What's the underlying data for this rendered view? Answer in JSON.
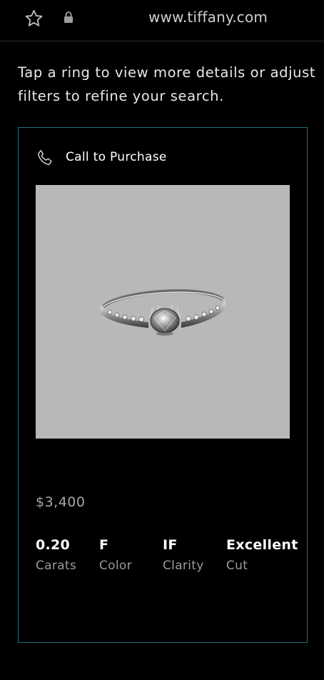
{
  "browser": {
    "url": "www.tiffany.com",
    "icons": [
      "star-icon",
      "lock-icon"
    ]
  },
  "intro_text": {
    "line1": "Tap a ring to view more details or adjust",
    "line2": "filters to refine your search."
  },
  "product": {
    "call_label": "Call to Purchase",
    "call_icon": "phone-icon",
    "price": "$3,400",
    "specs": [
      {
        "value": "0.20",
        "label": "Carats"
      },
      {
        "value": "F",
        "label": "Color"
      },
      {
        "value": "IF",
        "label": "Clarity"
      },
      {
        "value": "Excellent",
        "label": "Cut"
      }
    ]
  },
  "colors": {
    "background": "#000000",
    "card_border": "#1f6f7a",
    "image_bg": "#b8b8b8",
    "muted_text": "#9a9a9a"
  }
}
